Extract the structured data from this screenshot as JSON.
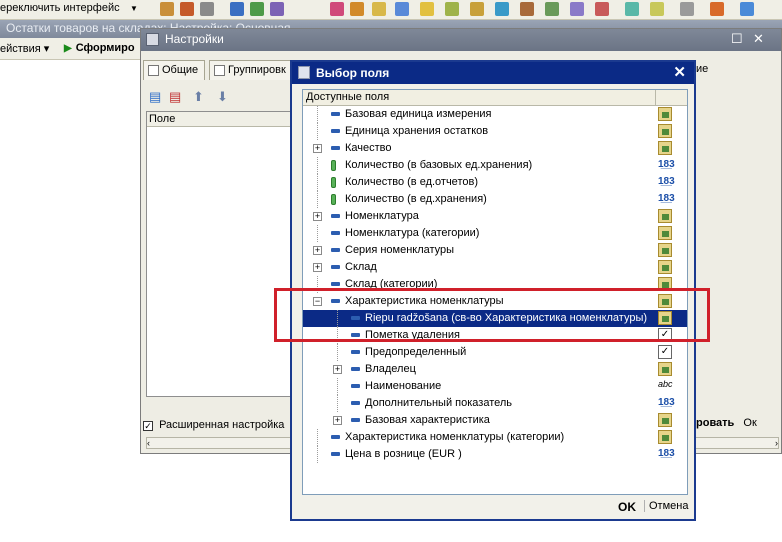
{
  "app": {
    "interface_menu": "ереключить интерфейс",
    "background_title": "Остатки товаров на складах: Настройка: Основная",
    "actions_menu": "ействия",
    "generate_button": "Сформиро"
  },
  "settings": {
    "title": "Настройки",
    "tabs": [
      "Общие",
      "Группировк"
    ],
    "tab_right": "ие",
    "fields_header": "Поле",
    "extended_settings": "Расширенная настройка",
    "right_button": "ровать",
    "right_button2": "Ок"
  },
  "dialog": {
    "title": "Выбор поля",
    "header": "Доступные поля",
    "ok": "OK",
    "cancel": "Отмена",
    "rows": [
      {
        "label": "Базовая единица измерения",
        "type_icon": "folder-icon",
        "field_icon": "attribute-icon",
        "expander": ""
      },
      {
        "label": "Единица хранения остатков",
        "type_icon": "folder-icon",
        "field_icon": "attribute-icon",
        "expander": ""
      },
      {
        "label": "Качество",
        "type_icon": "folder-icon",
        "field_icon": "attribute-icon",
        "expander": "+"
      },
      {
        "label": "Количество (в базовых ед.хранения)",
        "type_icon": "number-icon",
        "field_icon": "resource-icon",
        "expander": ""
      },
      {
        "label": "Количество (в ед.отчетов)",
        "type_icon": "number-icon",
        "field_icon": "resource-icon",
        "expander": ""
      },
      {
        "label": "Количество (в ед.хранения)",
        "type_icon": "number-icon",
        "field_icon": "resource-icon",
        "expander": ""
      },
      {
        "label": "Номенклатура",
        "type_icon": "folder-icon",
        "field_icon": "attribute-icon",
        "expander": "+"
      },
      {
        "label": "Номенклатура (категории)",
        "type_icon": "folder-icon",
        "field_icon": "attribute-icon",
        "expander": ""
      },
      {
        "label": "Серия номенклатуры",
        "type_icon": "folder-icon",
        "field_icon": "attribute-icon",
        "expander": "+"
      },
      {
        "label": "Склад",
        "type_icon": "folder-icon",
        "field_icon": "attribute-icon",
        "expander": "+"
      },
      {
        "label": "Склад (категории)",
        "type_icon": "folder-icon",
        "field_icon": "attribute-icon",
        "expander": ""
      },
      {
        "label": "Характеристика номенклатуры",
        "type_icon": "folder-icon",
        "field_icon": "attribute-icon",
        "expander": "−"
      },
      {
        "label": "Riepu radžošana (св-во Характеристика номенклатуры)",
        "type_icon": "folder-icon",
        "field_icon": "attribute-icon",
        "expander": ""
      },
      {
        "label": "Пометка удаления",
        "type_icon": "checkbox-icon",
        "field_icon": "attribute-icon",
        "expander": ""
      },
      {
        "label": "Предопределенный",
        "type_icon": "checkbox-icon",
        "field_icon": "attribute-icon",
        "expander": ""
      },
      {
        "label": "Владелец",
        "type_icon": "folder-icon",
        "field_icon": "attribute-icon",
        "expander": "+"
      },
      {
        "label": "Наименование",
        "type_icon": "string-icon",
        "field_icon": "attribute-icon",
        "expander": ""
      },
      {
        "label": "Дополнительный показатель",
        "type_icon": "number-icon",
        "field_icon": "attribute-icon",
        "expander": ""
      },
      {
        "label": "Базовая характеристика",
        "type_icon": "folder-icon",
        "field_icon": "attribute-icon",
        "expander": "+"
      },
      {
        "label": "Характеристика номенклатуры (категории)",
        "type_icon": "folder-icon",
        "field_icon": "attribute-icon",
        "expander": ""
      },
      {
        "label": "Цена в рознице (EUR )",
        "type_icon": "number-icon",
        "field_icon": "attribute-icon",
        "expander": ""
      }
    ],
    "selected_index": 12
  },
  "colors": {
    "dialog_title": "#0b2a86",
    "selection": "#0b2a86",
    "highlight": "#d0202a"
  }
}
